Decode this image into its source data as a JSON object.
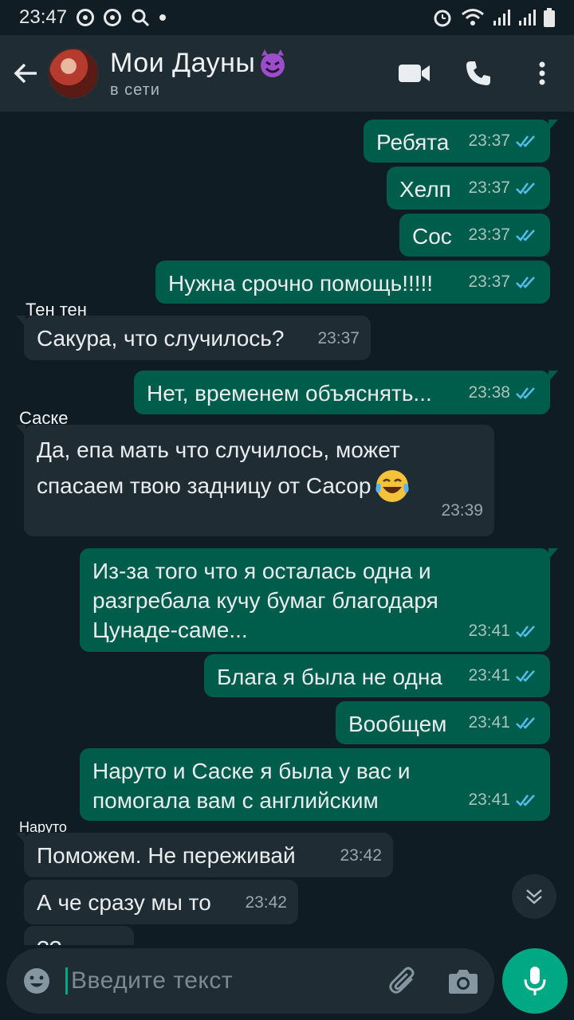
{
  "status_bar": {
    "time": "23:47"
  },
  "header": {
    "title": "Мои  Дауны",
    "status": "в сети",
    "icons": [
      "back-arrow-icon",
      "video-call-icon",
      "phone-icon",
      "more-vertical-icon"
    ]
  },
  "colors": {
    "outgoing_bubble": "#005c4b",
    "incoming_bubble": "#1f2c34",
    "background": "#0f1c24",
    "header": "#1f2c33",
    "accent": "#00a884",
    "read_ticks": "#53bdeb"
  },
  "messages": [
    {
      "dir": "out",
      "text": "Ребята",
      "time": "23:37"
    },
    {
      "dir": "out",
      "text": "Хелп",
      "time": "23:37"
    },
    {
      "dir": "out",
      "text": "Сос",
      "time": "23:37"
    },
    {
      "dir": "out",
      "text": "Нужна срочно помощь!!!!!",
      "time": "23:37"
    },
    {
      "dir": "in",
      "sender": "Тен  тен",
      "text": "Сакура, что случилось?",
      "time": "23:37"
    },
    {
      "dir": "out",
      "text": "Нет, временем объяснять...",
      "time": "23:38"
    },
    {
      "dir": "in",
      "sender": "Саске",
      "text_line1": "Да, епа мать что случилось, может",
      "text_line2": "спасаем твою задницу от Сасор",
      "emoji": "tears-of-joy-emoji",
      "time": "23:39"
    },
    {
      "dir": "out",
      "text_line1": "Из-за того что я осталась одна и",
      "text_line2": "разгребала кучу бумаг благодаря",
      "text_line3": "Цунаде-саме...",
      "time": "23:41"
    },
    {
      "dir": "out",
      "text": "Блага я была не одна",
      "time": "23:41"
    },
    {
      "dir": "out",
      "text": "Вообщем",
      "time": "23:41"
    },
    {
      "dir": "out",
      "text_line1": "Наруто и Саске я была у вас и",
      "text_line2": "помогала вам с английским",
      "time": "23:41"
    },
    {
      "dir": "in",
      "sender": "Наруто",
      "text": "Поможем. Не переживай",
      "time": "23:42"
    },
    {
      "dir": "in",
      "text": "А че сразу мы то",
      "time": "23:42"
    },
    {
      "dir": "in",
      "text": "??",
      "time": ""
    }
  ],
  "input": {
    "placeholder": "Введите текст",
    "icons": [
      "emoji-icon",
      "attach-icon",
      "camera-icon",
      "mic-icon"
    ]
  }
}
